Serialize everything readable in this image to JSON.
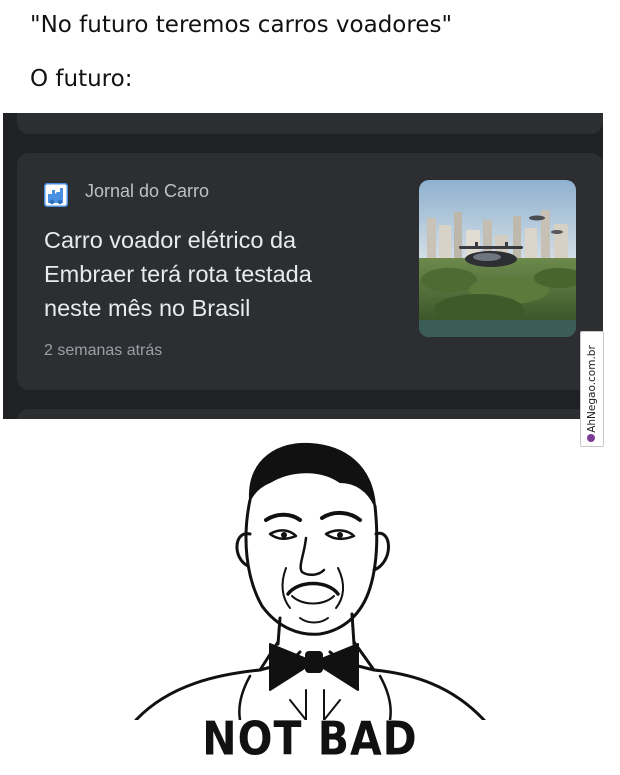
{
  "meme": {
    "caption_quote": "\"No futuro teremos carros voadores\"",
    "caption_future": "O futuro:",
    "reaction_text": "NOT BAD"
  },
  "news_card": {
    "publisher": "Jornal do Carro",
    "publisher_icon": "jornal-do-carro-logo-icon",
    "headline_lines": [
      "Carro voador elétrico da",
      "Embraer terá rota testada",
      "neste mês no Brasil"
    ],
    "time_ago": "2 semanas atrás",
    "thumbnail": "flying-car-over-city-image"
  },
  "watermark": {
    "text": "AhNegao.com.br"
  },
  "colors": {
    "feed_background": "#202124",
    "card_background": "#2d2e31",
    "headline_text": "#e8eaed",
    "publisher_text": "#bdc1c6",
    "meta_text": "#9aa0a6",
    "logo_blue": "#4a90e2"
  }
}
